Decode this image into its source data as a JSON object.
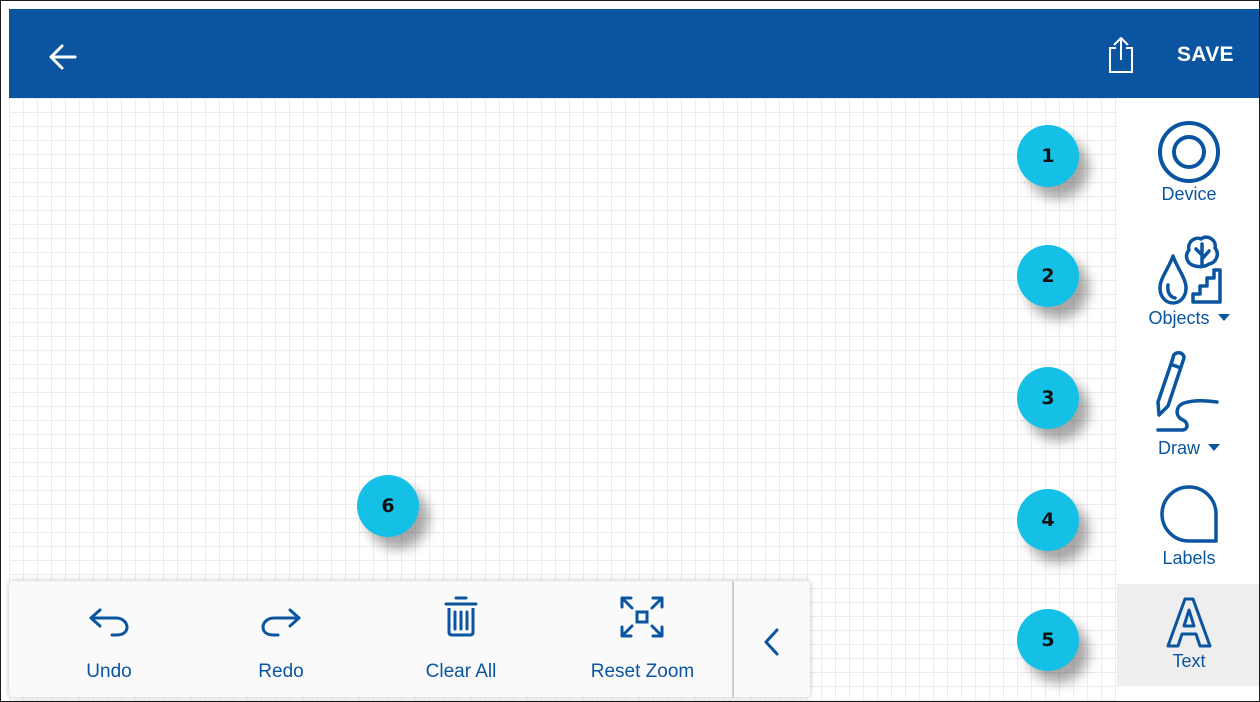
{
  "header": {
    "save_label": "SAVE",
    "back_icon": "arrow-left-icon",
    "share_icon": "share-icon"
  },
  "tools": [
    {
      "label": "Device",
      "icon": "device-icon",
      "has_dropdown": false
    },
    {
      "label": "Objects",
      "icon": "objects-icon",
      "has_dropdown": true
    },
    {
      "label": "Draw",
      "icon": "draw-icon",
      "has_dropdown": true
    },
    {
      "label": "Labels",
      "icon": "labels-icon",
      "has_dropdown": false
    },
    {
      "label": "Text",
      "icon": "text-icon",
      "has_dropdown": false,
      "active": true
    }
  ],
  "callouts": [
    "1",
    "2",
    "3",
    "4",
    "5",
    "6"
  ],
  "bottom_toolbar": {
    "undo_label": "Undo",
    "redo_label": "Redo",
    "clear_all_label": "Clear All",
    "reset_zoom_label": "Reset Zoom"
  },
  "colors": {
    "primary": "#0b55a0",
    "callout": "#14c0e6",
    "active_tool_bg": "#eeeeef",
    "grid_line": "#ececec"
  }
}
